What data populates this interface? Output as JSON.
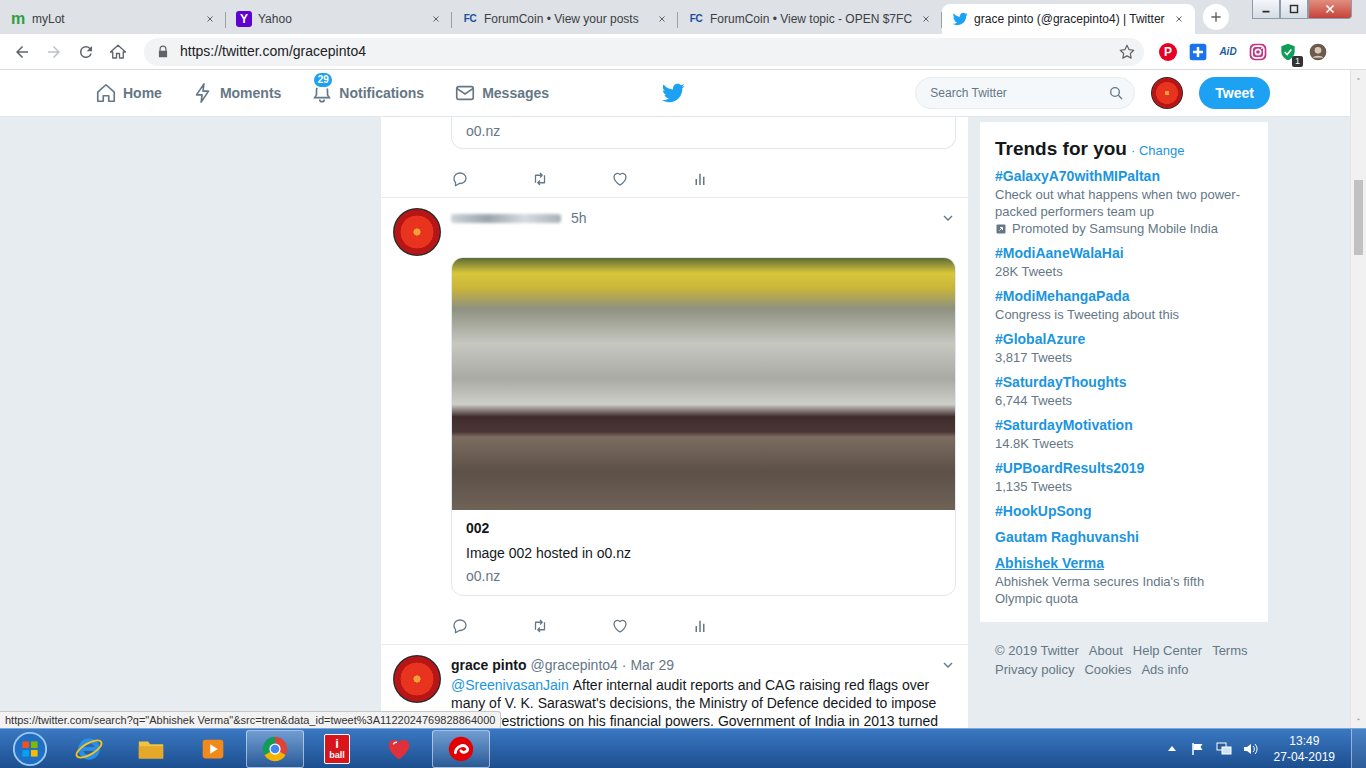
{
  "browser": {
    "tabs": [
      {
        "label": "myLot",
        "kind": "letter",
        "logo": "m",
        "color": "#2f9e44",
        "selected": false
      },
      {
        "label": "Yahoo",
        "kind": "badge",
        "logo": "Y",
        "color": "#5f01d1",
        "selected": false
      },
      {
        "label": "ForumCoin • View your posts",
        "kind": "letter",
        "logo": "FC",
        "color": "#1c4f9c",
        "selected": false
      },
      {
        "label": "ForumCoin • View topic - OPEN $7FC",
        "kind": "letter",
        "logo": "FC",
        "color": "#1c4f9c",
        "selected": false
      },
      {
        "label": "grace pinto (@gracepinto4) | Twitter",
        "kind": "twitter",
        "selected": true
      }
    ],
    "address": "https://twitter.com/gracepinto4",
    "extensions": [
      {
        "kind": "pinterest",
        "label": "P"
      },
      {
        "kind": "add"
      },
      {
        "kind": "text",
        "label": "AiD"
      },
      {
        "kind": "instagram"
      },
      {
        "kind": "shield",
        "badge": "1"
      },
      {
        "kind": "profile"
      }
    ]
  },
  "twitter": {
    "nav": [
      {
        "label": "Home",
        "kind": "home"
      },
      {
        "label": "Moments",
        "kind": "moments"
      },
      {
        "label": "Notifications",
        "kind": "notifications",
        "badge": "29"
      },
      {
        "label": "Messages",
        "kind": "messages"
      }
    ],
    "search": {
      "placeholder": "Search Twitter"
    },
    "tweet_button": "Tweet"
  },
  "timeline": {
    "tweets": [
      {
        "kind": "cut",
        "card": {
          "domain": "o0.nz"
        }
      },
      {
        "kind": "image",
        "time": "5h",
        "card": {
          "title": "002",
          "description": "Image 002 hosted in o0.nz",
          "domain": "o0.nz"
        }
      },
      {
        "kind": "text",
        "name": "grace pinto",
        "handle": "@gracepinto4",
        "time": "· Mar 29",
        "mention": "@SreenivasanJain",
        "lines": [
          "After internal audit reports and CAG raising red flags over",
          "many of V. K. Saraswat's decisions, the Ministry of Defence decided to impose",
          "severe restrictions on his financial powers. Government of India in 2013 turned"
        ]
      }
    ]
  },
  "trends": {
    "title": "Trends for you",
    "change": "· Change",
    "items": [
      {
        "name": "#GalaxyA70withMIPaltan",
        "detail": "Check out what happens when two power-packed performers team up",
        "promoted": "Promoted by Samsung Mobile India",
        "hovered": false
      },
      {
        "name": "#ModiAaneWalaHai",
        "detail": "28K Tweets",
        "hovered": false
      },
      {
        "name": "#ModiMehangaPada",
        "detail": "Congress is Tweeting about this",
        "hovered": false
      },
      {
        "name": "#GlobalAzure",
        "detail": "3,817 Tweets",
        "hovered": false
      },
      {
        "name": "#SaturdayThoughts",
        "detail": "6,744 Tweets",
        "hovered": false
      },
      {
        "name": "#SaturdayMotivation",
        "detail": "14.8K Tweets",
        "hovered": false
      },
      {
        "name": "#UPBoardResults2019",
        "detail": "1,135 Tweets",
        "hovered": false
      },
      {
        "name": "#HookUpSong",
        "hovered": false
      },
      {
        "name": "Gautam Raghuvanshi",
        "hovered": false
      },
      {
        "name": "Abhishek Verma",
        "detail": "Abhishek Verma secures India's fifth Olympic quota",
        "hovered": true
      }
    ]
  },
  "footer": {
    "copyright": "© 2019 Twitter",
    "links": [
      "About",
      "Help Center",
      "Terms",
      "Privacy policy",
      "Cookies",
      "Ads info"
    ]
  },
  "status_url": "https://twitter.com/search?q=\"Abhishek Verma\"&src=tren&data_id=tweet%3A1122024769828864000",
  "scroll": {
    "level": 0.17
  },
  "taskbar": {
    "apps": [
      {
        "kind": "ie",
        "running": false
      },
      {
        "kind": "explorer",
        "running": false
      },
      {
        "kind": "media",
        "running": false
      },
      {
        "kind": "chrome",
        "running": true
      },
      {
        "kind": "iball",
        "label": "i",
        "sublabel": "ball",
        "running": false
      },
      {
        "kind": "heart",
        "running": false
      },
      {
        "kind": "airtel",
        "running": true
      }
    ],
    "time": "13:49",
    "date": "27-04-2019"
  }
}
